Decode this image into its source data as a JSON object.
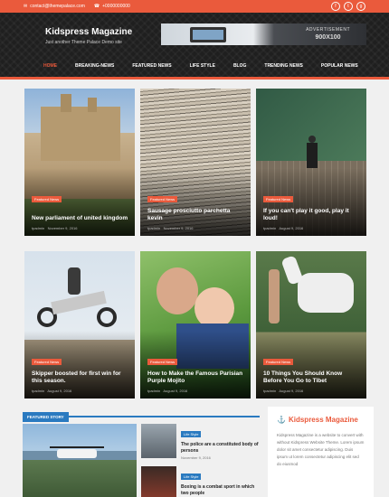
{
  "topbar": {
    "email": "contact@themepalace.com",
    "phone": "+0000000000",
    "social_icons": [
      "facebook-icon",
      "twitter-icon",
      "google-plus-icon"
    ]
  },
  "site": {
    "title": "Kidspress Magazine",
    "tagline": "Just another Theme Palace Demo site"
  },
  "ad": {
    "label": "ADVERTISEMENT",
    "size": "900X100"
  },
  "nav": {
    "items": [
      "HOME",
      "BREAKING-NEWS",
      "FEATURED NEWS",
      "LIFE STYLE",
      "BLOG",
      "TRENDING NEWS",
      "POPULAR NEWS"
    ],
    "active": "HOME"
  },
  "cards": [
    {
      "category": "Featured News",
      "title": "New parliament of united kingdom",
      "author": "tpadmin",
      "date": "November 9, 2016"
    },
    {
      "category": "Featured News",
      "title": "Sausage prosciutto parchetta kevin",
      "author": "tpadmin",
      "date": "November 9, 2016"
    },
    {
      "category": "Featured News",
      "title": "If you can't play it good, play it loud!",
      "author": "tpadmin",
      "date": "August 9, 2016"
    },
    {
      "category": "Featured News",
      "title": "Skipper boosted for first win for this season.",
      "author": "tpadmin",
      "date": "August 9, 2016"
    },
    {
      "category": "Featured News",
      "title": "How to Make the Famous Parisian Purple Mojito",
      "author": "tpadmin",
      "date": "August 9, 2016"
    },
    {
      "category": "Featured News",
      "title": "10 Things You Should Know Before You Go to Tibet",
      "author": "tpadmin",
      "date": "August 9, 2016"
    }
  ],
  "featured_story": {
    "label": "FEATURED STORY",
    "list": [
      {
        "category": "Life Style",
        "title": "The police are a constituted body of persons",
        "date": "November 9, 2016"
      },
      {
        "category": "Life Style",
        "title": "Boxing is a combat sport in which two people",
        "date": ""
      }
    ]
  },
  "widget": {
    "title": "Kidspress Magazine",
    "text": "Kidspress Magazine is a website to convert with without Kidspress Website Theme. Lorem ipsum dolor sit amet consectetur adipiscing. Duis ipsum ut lorem consectetur adipiscing elit sed do eiusmod"
  },
  "colors": {
    "accent": "#ea5a3c",
    "header_bg": "#1f1f1f",
    "feature_blue": "#2a7ac0"
  }
}
